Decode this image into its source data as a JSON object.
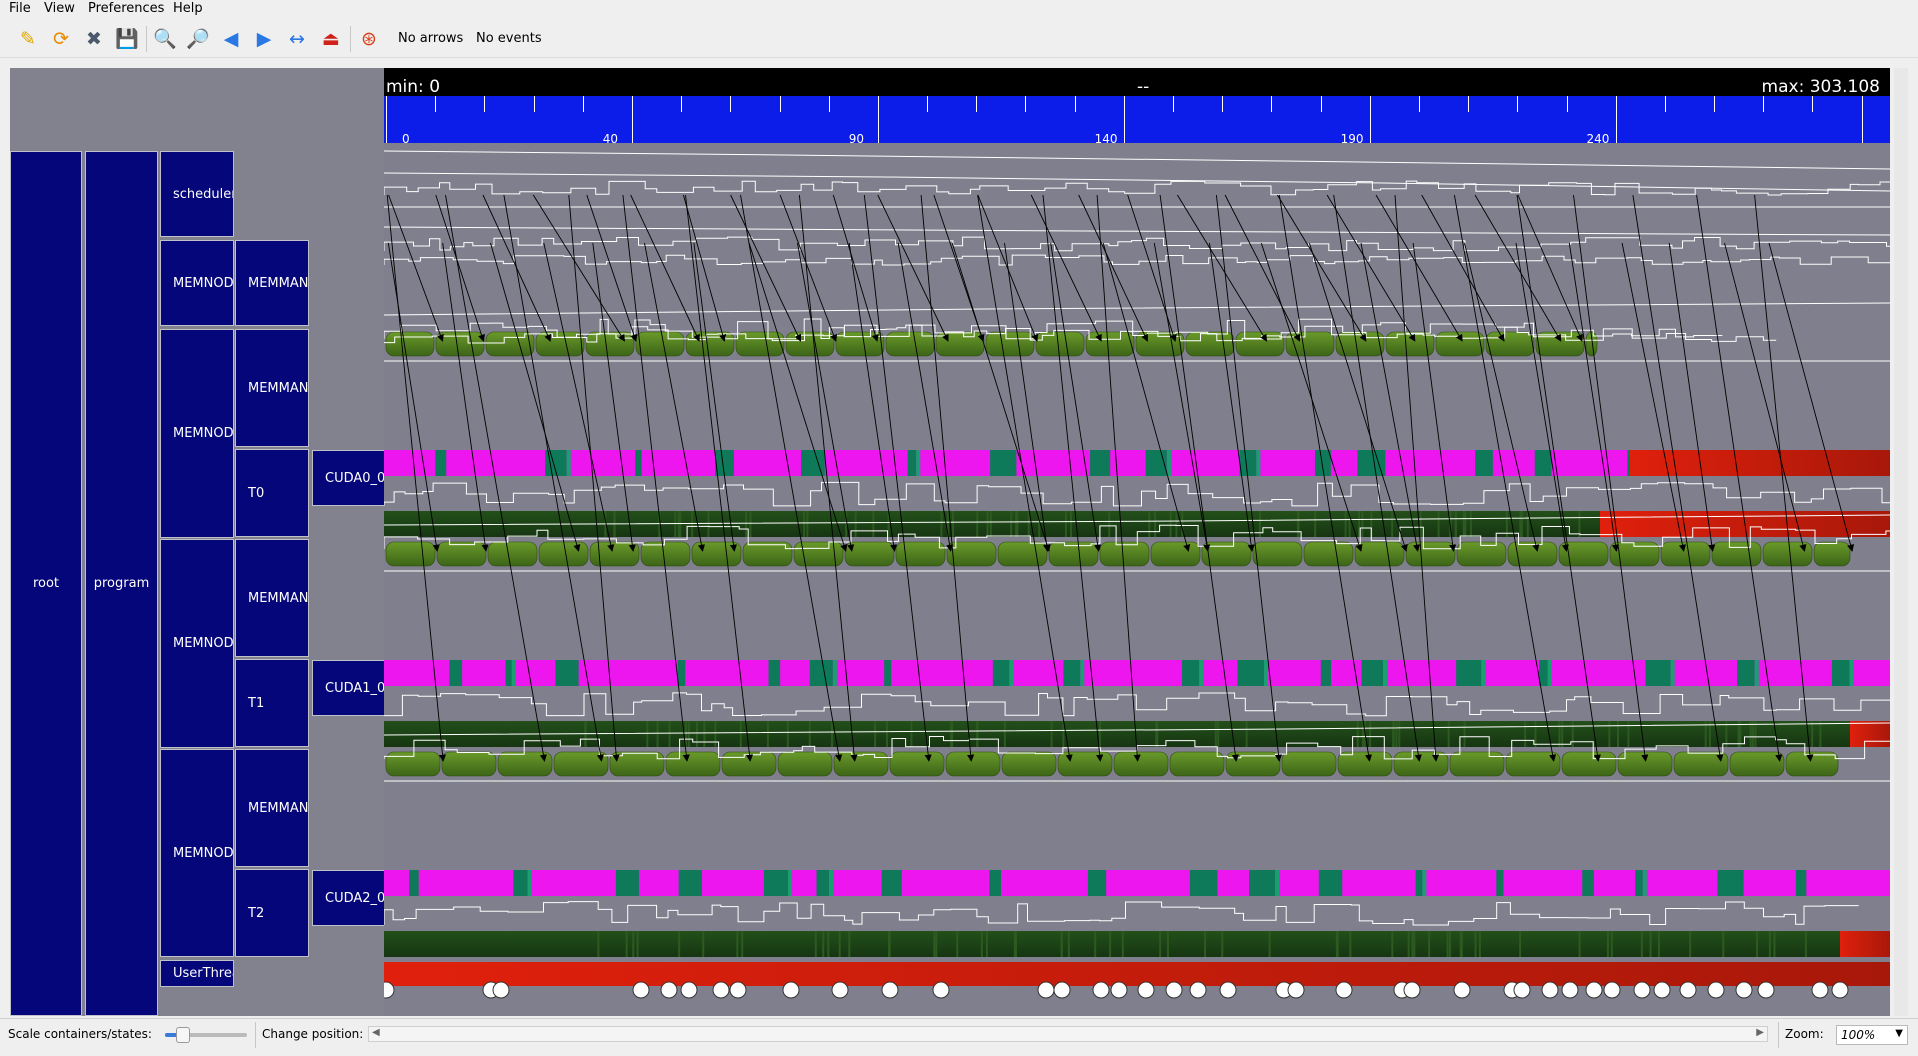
{
  "menu": [
    "File",
    "View",
    "Preferences",
    "Help"
  ],
  "toolbar": {
    "icons": [
      "open-icon",
      "reload-icon",
      "close-icon",
      "save-icon",
      "zoom-in-icon",
      "zoom-out-icon",
      "previous-icon",
      "next-icon",
      "fit-horizontal-icon",
      "eject-icon",
      "help-lifebuoy-icon"
    ],
    "arrows_label": "No arrows",
    "events_label": "No events"
  },
  "ruler": {
    "min_label": "min: 0",
    "cursor_label": "--",
    "max_label": "max: 303.108",
    "major_ticks": [
      "0",
      "40",
      "90",
      "140",
      "190",
      "240"
    ],
    "color": "#0c1dea"
  },
  "containers": {
    "root": "root",
    "program": "program",
    "scheduler": "scheduler",
    "memnode_1": "MEMNOD...",
    "memman_1": "MEMMAN...",
    "memnode_2": "MEMNOD...",
    "memman_2": "MEMMAN...",
    "t0": "T0",
    "cuda0": "CUDA0_0",
    "memnode_3": "MEMNOD...",
    "memman_3": "MEMMAN...",
    "t1": "T1",
    "cuda1": "CUDA1_0",
    "memnode_4": "MEMNOD...",
    "memman_4": "MEMMAN...",
    "t2": "T2",
    "cuda2": "CUDA2_0",
    "user_thread": "UserThrea..."
  },
  "colors": {
    "container": "#04067a",
    "background": "#7f7f8d",
    "state_magenta": "#ee16ee",
    "state_teal": "#0f7a5a",
    "state_dark_green": "#1c3e12",
    "state_green": "#4c7a20",
    "state_red": "#d51a0a"
  },
  "status": {
    "scale_label": "Scale containers/states:",
    "position_label": "Change position:",
    "zoom_label": "Zoom:",
    "zoom_value": "100%"
  }
}
